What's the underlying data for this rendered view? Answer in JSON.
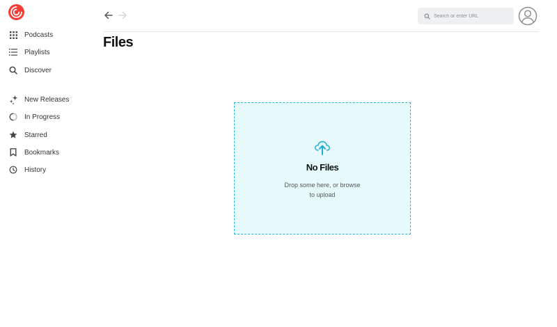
{
  "app": {
    "brand_color": "#f43e37",
    "accent_color": "#1faad0"
  },
  "sidebar": {
    "items": [
      {
        "label": "Podcasts",
        "icon": "grid-icon"
      },
      {
        "label": "Playlists",
        "icon": "list-icon"
      },
      {
        "label": "Discover",
        "icon": "search-icon"
      },
      {
        "label": "New Releases",
        "icon": "sparkle-icon"
      },
      {
        "label": "In Progress",
        "icon": "in-progress-icon"
      },
      {
        "label": "Starred",
        "icon": "star-icon"
      },
      {
        "label": "Bookmarks",
        "icon": "bookmark-icon"
      },
      {
        "label": "History",
        "icon": "clock-icon"
      }
    ]
  },
  "topbar": {
    "search_placeholder": "Search or enter URL"
  },
  "main": {
    "title": "Files",
    "empty_state": {
      "title": "No Files",
      "description": "Drop some here, or browse to upload"
    }
  }
}
